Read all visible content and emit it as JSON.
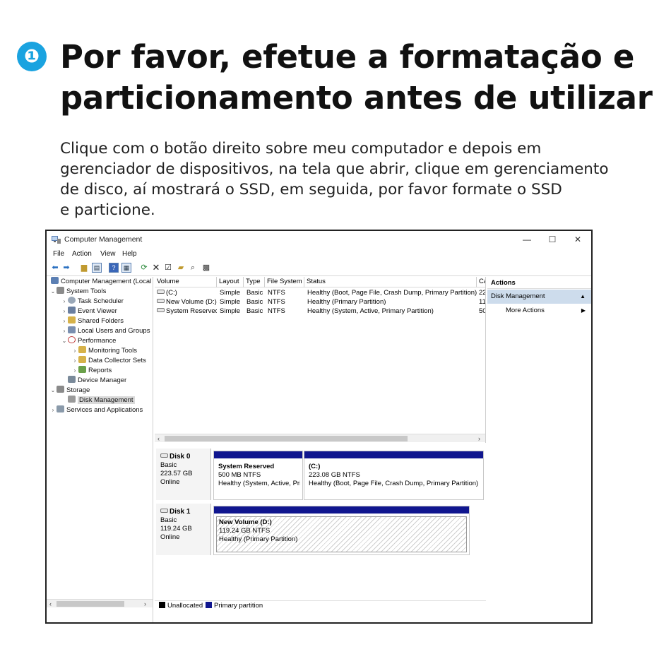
{
  "step": {
    "number": "❶"
  },
  "headline": {
    "line1": "Por favor, efetue a formatação e",
    "line2": "particionamento antes de utilizar"
  },
  "description": {
    "line1": "Clique com o botão direito sobre meu computador e depois em",
    "line2": "gerenciador de dispositivos, na tela que abrir, clique em gerenciamento",
    "line3": "de disco, aí mostrará o SSD, em seguida, por favor formate o SSD",
    "line4": "e particione."
  },
  "window": {
    "title": "Computer Management",
    "controls": {
      "minimize": "—",
      "maximize": "☐",
      "close": "✕"
    },
    "menu": [
      "File",
      "Action",
      "View",
      "Help"
    ]
  },
  "tree": {
    "items": [
      {
        "label": "Computer Management (Local",
        "arrow": "",
        "icon_color": "#5b7fb3"
      },
      {
        "label": "System Tools",
        "arrow": "⌄",
        "icon_color": "#8a8a8a"
      },
      {
        "label": "Task Scheduler",
        "arrow": "›",
        "icon_color": "#9aa8b8"
      },
      {
        "label": "Event Viewer",
        "arrow": "›",
        "icon_color": "#6a7fa0"
      },
      {
        "label": "Shared Folders",
        "arrow": "›",
        "icon_color": "#d6b24a"
      },
      {
        "label": "Local Users and Groups",
        "arrow": "›",
        "icon_color": "#7a8fb0"
      },
      {
        "label": "Performance",
        "arrow": "⌄",
        "icon_color": "#c04040"
      },
      {
        "label": "Monitoring Tools",
        "arrow": "›",
        "icon_color": "#d6b24a"
      },
      {
        "label": "Data Collector Sets",
        "arrow": "›",
        "icon_color": "#d6b24a"
      },
      {
        "label": "Reports",
        "arrow": "›",
        "icon_color": "#6aa04a"
      },
      {
        "label": "Device Manager",
        "arrow": "",
        "icon_color": "#7a8a9a"
      },
      {
        "label": "Storage",
        "arrow": "⌄",
        "icon_color": "#8a8a8a"
      },
      {
        "label": "Disk Management",
        "arrow": "",
        "icon_color": "#9a9a9a"
      },
      {
        "label": "Services and Applications",
        "arrow": "›",
        "icon_color": "#8a9aaa"
      }
    ]
  },
  "volume_list": {
    "columns": [
      "Volume",
      "Layout",
      "Type",
      "File System",
      "Status",
      "Ca"
    ],
    "rows": [
      {
        "volume": "(C:)",
        "layout": "Simple",
        "type": "Basic",
        "fs": "NTFS",
        "status": "Healthy (Boot, Page File, Crash Dump, Primary Partition)",
        "cap": "22"
      },
      {
        "volume": "New Volume (D:)",
        "layout": "Simple",
        "type": "Basic",
        "fs": "NTFS",
        "status": "Healthy (Primary Partition)",
        "cap": "11"
      },
      {
        "volume": "System Reserved",
        "layout": "Simple",
        "type": "Basic",
        "fs": "NTFS",
        "status": "Healthy (System, Active, Primary Partition)",
        "cap": "50"
      }
    ]
  },
  "disks": [
    {
      "name": "Disk 0",
      "type": "Basic",
      "size": "223.57 GB",
      "state": "Online",
      "partitions": [
        {
          "name": "System Reserved",
          "size": "500 MB NTFS",
          "status": "Healthy (System, Active, Prir"
        },
        {
          "name": "(C:)",
          "size": "223.08 GB NTFS",
          "status": "Healthy (Boot, Page File, Crash Dump, Primary Partition)"
        }
      ]
    },
    {
      "name": "Disk 1",
      "type": "Basic",
      "size": "119.24 GB",
      "state": "Online",
      "partitions": [
        {
          "name": "New Volume  (D:)",
          "size": "119.24 GB NTFS",
          "status": "Healthy (Primary Partition)"
        }
      ]
    }
  ],
  "legend": {
    "unallocated": "Unallocated",
    "primary": "Primary partition"
  },
  "actions": {
    "header": "Actions",
    "section": "Disk Management",
    "item": "More Actions"
  },
  "colors": {
    "accent": "#1aa3e0",
    "partition_bar": "#10168f",
    "actions_section": "#cddcec"
  }
}
